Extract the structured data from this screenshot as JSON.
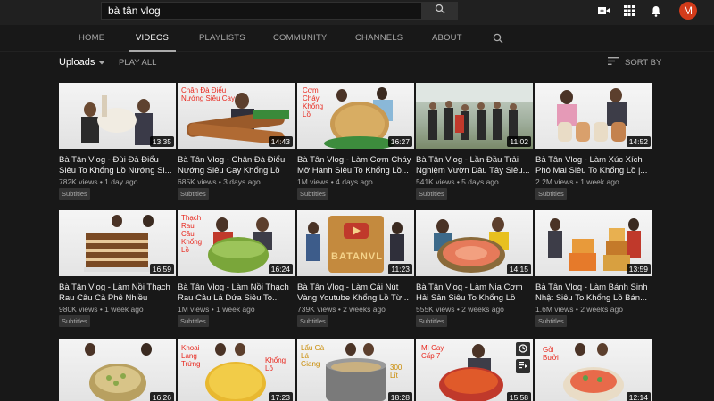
{
  "search": {
    "value": "bà tân vlog"
  },
  "avatar": {
    "initial": "M"
  },
  "tabs": [
    {
      "label": "HOME"
    },
    {
      "label": "VIDEOS"
    },
    {
      "label": "PLAYLISTS"
    },
    {
      "label": "COMMUNITY"
    },
    {
      "label": "CHANNELS"
    },
    {
      "label": "ABOUT"
    }
  ],
  "filter": {
    "uploads_label": "Uploads",
    "play_all_label": "PLAY ALL",
    "sort_label": "SORT BY"
  },
  "videos": [
    {
      "title": "Bà Tân Vlog - Đùi Đà Điểu Siêu To Khổng Lồ Nướng Si...",
      "views": "782K views",
      "age": "1 day ago",
      "duration": "13:35",
      "badge": "Subtitles",
      "caption": ""
    },
    {
      "title": "Bà Tân Vlog - Chân Đà Điểu Nướng Siêu Cay Khổng Lồ",
      "views": "685K views",
      "age": "3 days ago",
      "duration": "14:43",
      "badge": "Subtitles",
      "caption": "Chân Đà Điểu Nướng Siêu Cay"
    },
    {
      "title": "Bà Tân Vlog - Làm Cơm Cháy Mỡ Hành Siêu To Khổng Lồ...",
      "views": "1M views",
      "age": "4 days ago",
      "duration": "16:27",
      "badge": "Subtitles",
      "caption": "Cơm Cháy Khổng Lồ"
    },
    {
      "title": "Bà Tân Vlog - Lần Đầu Trải Nghiệm Vườn Dâu Tây Siêu...",
      "views": "541K views",
      "age": "5 days ago",
      "duration": "11:02",
      "badge": "Subtitles",
      "caption": ""
    },
    {
      "title": "Bà Tân Vlog - Làm Xúc Xích Phô Mai Siêu To Khổng Lồ |...",
      "views": "2.2M views",
      "age": "1 week ago",
      "duration": "14:52",
      "badge": "Subtitles",
      "caption": ""
    },
    {
      "title": "Bà Tân Vlog - Làm Nồi Thạch Rau Câu Cà Phê Nhiều Tầng...",
      "views": "980K views",
      "age": "1 week ago",
      "duration": "16:59",
      "badge": "Subtitles",
      "caption": ""
    },
    {
      "title": "Bà Tân Vlog - Làm Nồi Thạch Rau Câu Lá Dứa Siêu To...",
      "views": "1M views",
      "age": "1 week ago",
      "duration": "16:24",
      "badge": "Subtitles",
      "caption": "Thạch Rau Câu Khổng Lồ"
    },
    {
      "title": "Bà Tân Vlog - Làm Cái Nút Vàng Youtube Khổng Lồ Từ...",
      "views": "739K views",
      "age": "2 weeks ago",
      "duration": "11:23",
      "badge": "Subtitles",
      "caption": "BATANVL"
    },
    {
      "title": "Bà Tân Vlog - Làm Nia Cơm Hải Sản Siêu To Khổng Lồ",
      "views": "555K views",
      "age": "2 weeks ago",
      "duration": "14:15",
      "badge": "Subtitles",
      "caption": ""
    },
    {
      "title": "Bà Tân Vlog - Làm Bánh Sinh Nhật Siêu To Khổng Lồ Bán...",
      "views": "1.6M views",
      "age": "2 weeks ago",
      "duration": "13:59",
      "badge": "Subtitles",
      "caption": ""
    },
    {
      "title": "",
      "views": "",
      "age": "",
      "duration": "16:26",
      "badge": "",
      "caption": ""
    },
    {
      "title": "",
      "views": "",
      "age": "",
      "duration": "17:23",
      "badge": "",
      "caption": "Khoai Lang Trứng",
      "caption2": "Khổng Lồ"
    },
    {
      "title": "",
      "views": "",
      "age": "",
      "duration": "18:28",
      "badge": "",
      "caption": "Lẩu Gà Lá Giang",
      "caption2": "300 Lít"
    },
    {
      "title": "",
      "views": "",
      "age": "",
      "duration": "15:58",
      "badge": "",
      "caption": "Mì Cay Cấp 7"
    },
    {
      "title": "",
      "views": "",
      "age": "",
      "duration": "12:14",
      "badge": "",
      "caption": "Gỏi Bưởi"
    }
  ],
  "colors": {
    "background": "#181818",
    "topbar": "#202020",
    "avatar": "#d33b1a",
    "caption_red": "#e8281e"
  },
  "icons": [
    "search-icon",
    "video-camera-icon",
    "apps-grid-icon",
    "bell-icon",
    "channel-search-icon",
    "sort-icon",
    "dropdown-caret-icon",
    "clock-icon",
    "queue-icon"
  ]
}
